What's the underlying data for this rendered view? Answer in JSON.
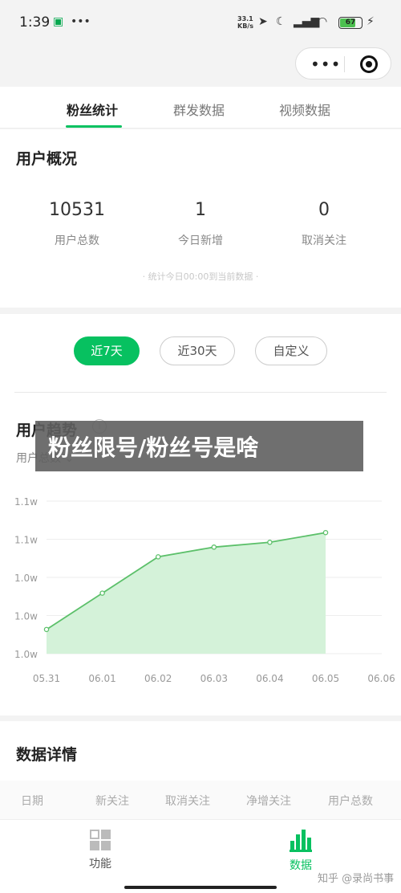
{
  "status_bar": {
    "time": "1:39",
    "network_speed_value": "33.1",
    "network_speed_unit": "KB/s",
    "battery": "67"
  },
  "tabs": [
    {
      "label": "粉丝统计",
      "active": true
    },
    {
      "label": "群发数据",
      "active": false
    },
    {
      "label": "视频数据",
      "active": false
    }
  ],
  "overview": {
    "title": "用户概况",
    "stats": [
      {
        "value": "10531",
        "label": "用户总数"
      },
      {
        "value": "1",
        "label": "今日新增"
      },
      {
        "value": "0",
        "label": "取消关注"
      }
    ],
    "note": "· 统计今日00:00到当前数据 ·"
  },
  "trend": {
    "range_buttons": [
      {
        "label": "近7天",
        "active": true
      },
      {
        "label": "近30天",
        "active": false
      },
      {
        "label": "自定义",
        "active": false
      }
    ],
    "title": "用户趋势",
    "info_glyph": "i",
    "selector": "用户总数"
  },
  "overlay_banner": "粉丝限号/粉丝号是啥",
  "chart_data": {
    "type": "area",
    "x": [
      "05.31",
      "06.01",
      "06.02",
      "06.03",
      "06.04",
      "06.05",
      "06.06"
    ],
    "values": [
      10490,
      10505,
      10520,
      10524,
      10526,
      10530
    ],
    "y_tick_labels": [
      "1.1w",
      "1.1w",
      "1.0w",
      "1.0w",
      "1.0w"
    ],
    "ylim": [
      10480,
      10543
    ],
    "grid": true,
    "color": "#5cc06a",
    "fill_color": "#d4f2d9"
  },
  "details": {
    "title": "数据详情",
    "columns": [
      "日期",
      "新关注",
      "取消关注",
      "净增关注",
      "用户总数"
    ]
  },
  "bottom_nav": [
    {
      "label": "功能",
      "icon": "grid-icon",
      "active": false
    },
    {
      "label": "数据",
      "icon": "bar-chart-icon",
      "active": true
    }
  ],
  "watermark": "知乎 @录尚书事",
  "colors": {
    "accent": "#07c160"
  }
}
